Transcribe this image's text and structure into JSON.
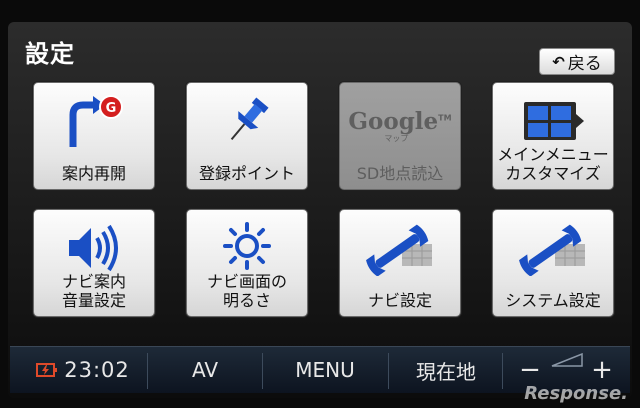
{
  "header": {
    "title": "設定",
    "back_label": "戻る"
  },
  "tiles": [
    {
      "label": "案内再開"
    },
    {
      "label": "登録ポイント"
    },
    {
      "label": "SD地点読込",
      "logo_text": "Google",
      "logo_sub": "マップ",
      "enabled": false
    },
    {
      "label": "メインメニュー\nカスタマイズ"
    },
    {
      "label": "ナビ案内\n音量設定"
    },
    {
      "label": "ナビ画面の\n明るさ"
    },
    {
      "label": "ナビ設定"
    },
    {
      "label": "システム設定"
    }
  ],
  "bottom_bar": {
    "time": "23:02",
    "av_label": "AV",
    "menu_label": "MENU",
    "location_label": "現在地",
    "zoom_out": "−",
    "zoom_in": "+"
  },
  "watermark": "Response.",
  "colors": {
    "accent_blue": "#1a4fc4",
    "disabled_tile": "#9a9a9a",
    "bar_bg": "#141c28"
  }
}
